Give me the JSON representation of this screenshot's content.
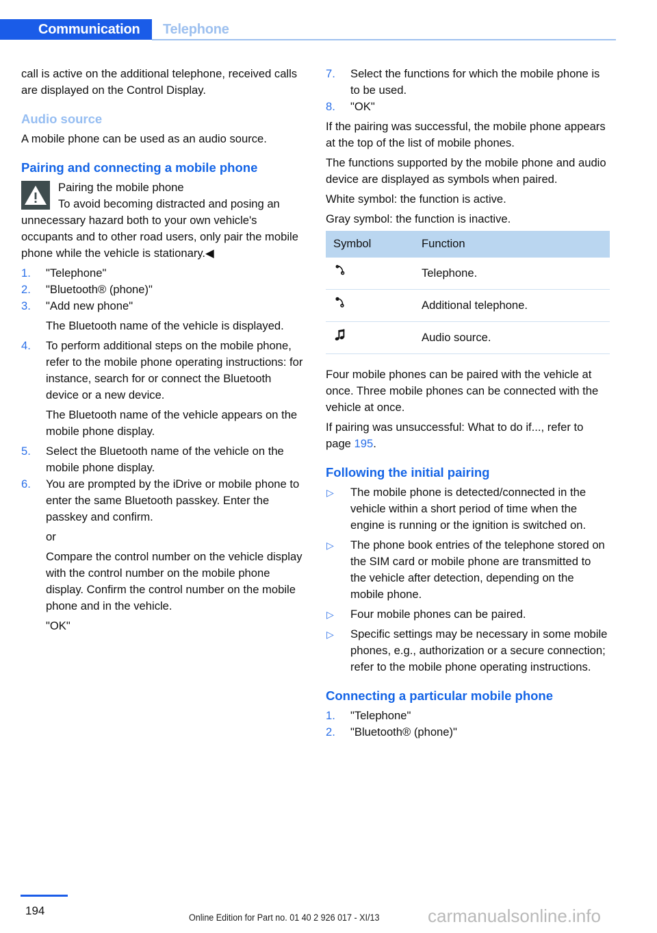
{
  "header": {
    "primary_tab": "Communication",
    "secondary_tab": "Telephone"
  },
  "left_column": {
    "intro_paragraph": "call is active on the additional telephone, received calls are displayed on the Control Display.",
    "audio_source_heading": "Audio source",
    "audio_source_paragraph": "A mobile phone can be used as an audio source.",
    "pairing_heading": "Pairing and connecting a mobile phone",
    "warning": {
      "icon": "warning-triangle-icon",
      "title": "Pairing the mobile phone",
      "body": "To avoid becoming distracted and posing an unnecessary hazard both to your own vehicle's occupants and to other road users, only pair the mobile phone while the vehicle is stationary.◀"
    },
    "steps": [
      {
        "number": "1.",
        "text": "\"Telephone\""
      },
      {
        "number": "2.",
        "text": "\"Bluetooth® (phone)\""
      },
      {
        "number": "3.",
        "text": "\"Add new phone\""
      },
      {
        "number": "4.",
        "text": "To perform additional steps on the mobile phone, refer to the mobile phone operating instructions: for instance, search for or connect the Bluetooth device or a new device."
      },
      {
        "number": "5.",
        "text": "Select the Bluetooth name of the vehicle on the mobile phone display."
      },
      {
        "number": "6.",
        "text": "You are prompted by the iDrive or mobile phone to enter the same Bluetooth passkey. Enter the passkey and confirm."
      }
    ],
    "step3_note": "The Bluetooth name of the vehicle is displayed.",
    "step4_note": "The Bluetooth name of the vehicle appears on the mobile phone display.",
    "step6_or": "or",
    "step6_alt": "Compare the control number on the vehicle display with the control number on the mobile phone display. Confirm the control number on the mobile phone and in the vehicle.",
    "step6_ok": "\"OK\""
  },
  "right_column": {
    "steps": [
      {
        "number": "7.",
        "text": "Select the functions for which the mobile phone is to be used."
      },
      {
        "number": "8.",
        "text": "\"OK\""
      }
    ],
    "paragraph_success": "If the pairing was successful, the mobile phone appears at the top of the list of mobile phones.",
    "paragraph_symbols": "The functions supported by the mobile phone and audio device are displayed as symbols when paired.",
    "paragraph_white": "White symbol: the function is active.",
    "paragraph_gray": "Gray symbol: the function is inactive.",
    "symbol_table": {
      "columns": [
        "Symbol",
        "Function"
      ],
      "rows": [
        {
          "symbol": "telephone-handset-outline-icon",
          "function": "Telephone."
        },
        {
          "symbol": "additional-telephone-handset-icon",
          "function": "Additional telephone."
        },
        {
          "symbol": "music-note-icon",
          "function": "Audio source."
        }
      ]
    },
    "paragraph_four_phones": "Four mobile phones can be paired with the vehicle at once. Three mobile phones can be connected with the vehicle at once.",
    "paragraph_unsuccessful_prefix": "If pairing was unsuccessful: What to do if..., refer to page ",
    "paragraph_unsuccessful_page": "195",
    "paragraph_unsuccessful_suffix": ".",
    "following_heading": "Following the initial pairing",
    "bullets": [
      {
        "marker": "▷",
        "text": "The mobile phone is detected/connected in the vehicle within a short period of time when the engine is running or the ignition is switched on."
      },
      {
        "marker": "▷",
        "text": "The phone book entries of the telephone stored on the SIM card or mobile phone are transmitted to the vehicle after detection, depending on the mobile phone."
      },
      {
        "marker": "▷",
        "text": "Four mobile phones can be paired."
      },
      {
        "marker": "▷",
        "text": "Specific settings may be necessary in some mobile phones, e.g., authorization or a secure connection; refer to the mobile phone operating instructions."
      }
    ],
    "connecting_heading": "Connecting a particular mobile phone",
    "connecting_steps": [
      {
        "number": "1.",
        "text": "\"Telephone\""
      },
      {
        "number": "2.",
        "text": "\"Bluetooth® (phone)\""
      }
    ]
  },
  "footer": {
    "page_number": "194",
    "edition": "Online Edition for Part no. 01 40 2 926 017 - XI/13",
    "watermark": "carmanualsonline.info"
  },
  "colors": {
    "tab_blue": "#1a5ce8",
    "heading_blue": "#1464e6",
    "subheading_blue": "#95bdf2",
    "list_marker_blue": "#2a6fe8",
    "table_header_blue": "#bad6f0",
    "table_rule_blue": "#cfe0f2",
    "warning_icon_bg": "#3e4c4e",
    "watermark_gray": "#b9b9b9"
  }
}
